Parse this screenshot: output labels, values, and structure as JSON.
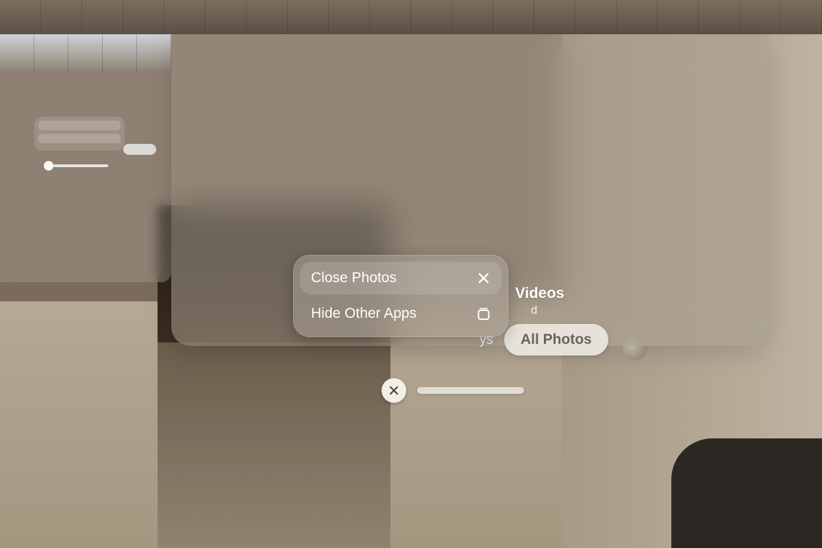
{
  "window": {
    "title_fragment": "Videos",
    "subtitle_fragment": "d",
    "segment_partial": "ys",
    "pill_label": "All Photos"
  },
  "popup": {
    "items": [
      {
        "label": "Close Photos",
        "icon": "close-icon",
        "highlight": true
      },
      {
        "label": "Hide Other Apps",
        "icon": "stack-icon",
        "highlight": false
      }
    ]
  },
  "controls": {
    "close_aria": "Close"
  }
}
